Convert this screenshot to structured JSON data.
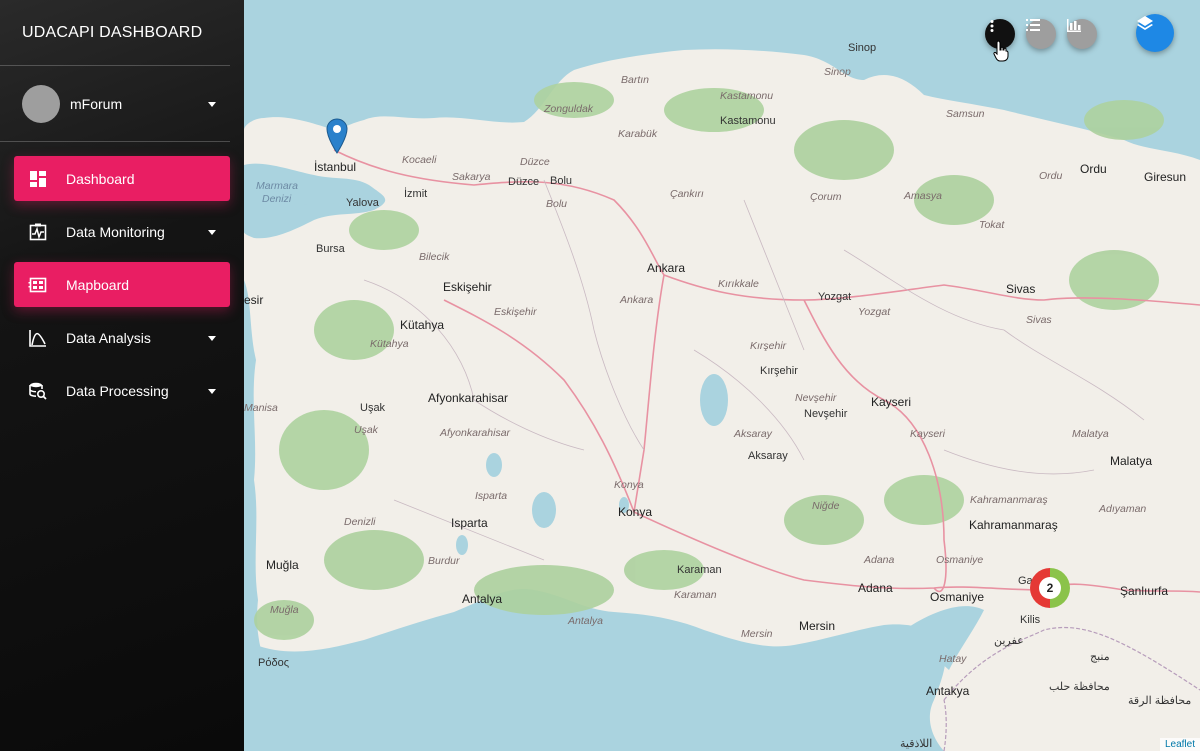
{
  "sidebar": {
    "brand": "UDACAPI DASHBOARD",
    "user": {
      "name": "mForum"
    },
    "items": [
      {
        "label": "Dashboard",
        "icon": "dashboard-icon",
        "active": true
      },
      {
        "label": "Data Monitoring",
        "icon": "monitoring-icon",
        "active": false
      },
      {
        "label": "Mapboard",
        "icon": "mapboard-icon",
        "active": true
      },
      {
        "label": "Data Analysis",
        "icon": "analysis-icon",
        "active": false
      },
      {
        "label": "Data Processing",
        "icon": "processing-icon",
        "active": false
      }
    ]
  },
  "map": {
    "controls": {
      "more": "more-vert-icon",
      "list": "list-icon",
      "chart": "bar-chart-icon",
      "layers": "layers-icon"
    },
    "cluster_count": "2",
    "attribution": "Leaflet",
    "labels": {
      "istanbul": "İstanbul",
      "kocaeli": "Kocaeli",
      "izmit": "İzmit",
      "sakarya": "Sakarya",
      "duzce_it": "Düzce",
      "duzce": "Düzce",
      "bolu": "Bolu",
      "bolu_it": "Bolu",
      "yalova": "Yalova",
      "marmara": "Marmara",
      "denizi": "Denizi",
      "bursa": "Bursa",
      "bilecik": "Bilecik",
      "zonguldak": "Zonguldak",
      "bartin": "Bartın",
      "karabuk": "Karabük",
      "kastamonu_it": "Kastamonu",
      "kastamonu": "Kastamonu",
      "sinop": "Sinop",
      "sinop_it": "Sinop",
      "samsun": "Samsun",
      "ordu": "Ordu",
      "ordu_it": "Ordu",
      "giresun": "Giresun",
      "cankiri": "Çankırı",
      "corum": "Çorum",
      "amasya": "Amasya",
      "tokat": "Tokat",
      "ankara": "Ankara",
      "ankara_it": "Ankara",
      "kirikkale": "Kırıkkale",
      "yozgat": "Yozgat",
      "yozgat_it": "Yozgat",
      "sivas": "Sivas",
      "sivas_it": "Sivas",
      "eskisehir": "Eskişehir",
      "eskisehir_it": "Eskişehir",
      "kutahya": "Kütahya",
      "kutahya_it": "Kütahya",
      "kirsehir_it": "Kırşehir",
      "kirsehir": "Kırşehir",
      "nevsehir_it": "Nevşehir",
      "nevsehir": "Nevşehir",
      "kayseri": "Kayseri",
      "kayseri_it": "Kayseri",
      "malatya_it": "Malatya",
      "malatya": "Malatya",
      "afyon": "Afyonkarahisar",
      "afyon_it": "Afyonkarahisar",
      "usak": "Uşak",
      "usak_it": "Uşak",
      "manisa": "Manisa",
      "aksaray_it": "Aksaray",
      "aksaray": "Aksaray",
      "konya_it": "Konya",
      "konya": "Konya",
      "nigde": "Niğde",
      "kahramanmaras_it": "Kahramanmaraş",
      "kahramanmaras": "Kahramanmaraş",
      "adiyaman": "Adıyaman",
      "isparta_it": "Isparta",
      "isparta": "Isparta",
      "denizli": "Denizli",
      "burdur": "Burdur",
      "mugla": "Muğla",
      "mugla_it": "Muğla",
      "antalya": "Antalya",
      "antalya_it": "Antalya",
      "karaman": "Karaman",
      "karaman_it": "Karaman",
      "adana_it": "Adana",
      "adana": "Adana",
      "osmaniye_it": "Osmaniye",
      "osmaniye": "Osmaniye",
      "sanliurfa": "Şanlıurfa",
      "mersin_it": "Mersin",
      "mersin": "Mersin",
      "kilis": "Kilis",
      "hatay": "Hatay",
      "antakya": "Antakya",
      "esir": "esir",
      "rodos": "Ρόδος",
      "afrin": "عفرين",
      "manbij": "منبج",
      "aleppo": "محافظة حلب",
      "raqqa": "محافظة الرقة",
      "latakia": "اللاذقية",
      "ga": "Ga"
    }
  }
}
